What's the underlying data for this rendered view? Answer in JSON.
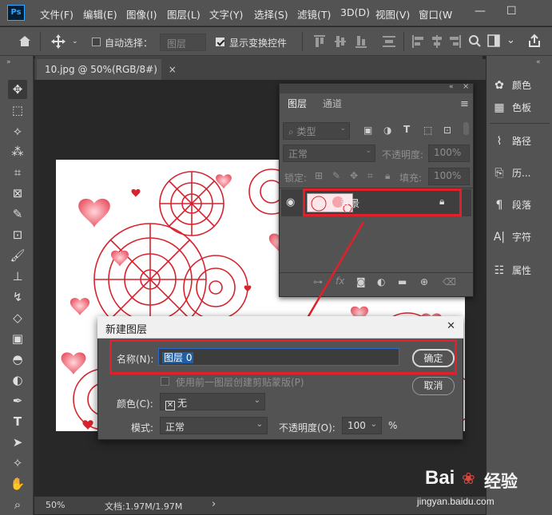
{
  "menu": [
    "文件(F)",
    "编辑(E)",
    "图像(I)",
    "图层(L)",
    "文字(Y)",
    "选择(S)",
    "滤镜(T)",
    "3D(D)",
    "视图(V)",
    "窗口(W"
  ],
  "window_controls": {
    "minimize": "—",
    "maximize": "☐"
  },
  "options": {
    "auto_select_label": "自动选择：",
    "auto_select_target": "图层",
    "show_transform_label": "显示变换控件"
  },
  "document_tab": {
    "title": "10.jpg @ 50%(RGB/8#)",
    "close": "×"
  },
  "status": {
    "zoom": "50%",
    "doc_info": "文档:1.97M/1.97M",
    "arrow": "›"
  },
  "right_panel": [
    "颜色",
    "色板",
    "路径",
    "历...",
    "段落",
    "字符",
    "属性"
  ],
  "layers_panel": {
    "tabs": [
      "图层",
      "通道"
    ],
    "filter_kind": "类型",
    "blend_mode": "正常",
    "opacity_label": "不透明度:",
    "opacity_value": "100%",
    "lock_label": "锁定:",
    "fill_label": "填充:",
    "fill_value": "100%",
    "layer_name": "背景"
  },
  "dialog": {
    "title": "新建图层",
    "close": "✕",
    "name_label": "名称(N):",
    "name_value": "图层 0",
    "ok": "确定",
    "cancel": "取消",
    "clip_label": "使用前一图层创建剪贴蒙版(P)",
    "color_label": "颜色(C):",
    "color_value": "无",
    "mode_label": "模式:",
    "mode_value": "正常",
    "opacity_label": "不透明度(O):",
    "opacity_value": "100",
    "opacity_unit": "%"
  },
  "watermark": {
    "brand": "Bai",
    "brand2": "经验",
    "url": "jingyan.baidu.com"
  },
  "colors": {
    "highlight": "#e0202a",
    "select": "#1f5fa8"
  }
}
